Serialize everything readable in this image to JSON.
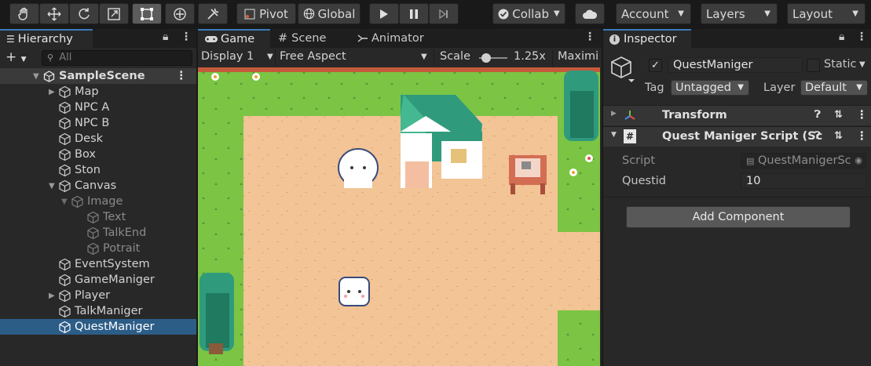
{
  "toolbar": {
    "pivot_label": "Pivot",
    "global_label": "Global",
    "collab_label": "Collab",
    "account_label": "Account",
    "layers_label": "Layers",
    "layout_label": "Layout"
  },
  "hierarchy": {
    "tab_label": "Hierarchy",
    "add_label": "+",
    "search_placeholder": "All",
    "scene_name": "SampleScene",
    "items": [
      {
        "label": "Map"
      },
      {
        "label": "NPC A"
      },
      {
        "label": "NPC B"
      },
      {
        "label": "Desk"
      },
      {
        "label": "Box"
      },
      {
        "label": "Ston"
      },
      {
        "label": "Canvas"
      },
      {
        "label": "Image"
      },
      {
        "label": "Text"
      },
      {
        "label": "TalkEnd"
      },
      {
        "label": "Potrait"
      },
      {
        "label": "EventSystem"
      },
      {
        "label": "GameManiger"
      },
      {
        "label": "Player"
      },
      {
        "label": "TalkManiger"
      },
      {
        "label": "QuestManiger"
      }
    ]
  },
  "game_view": {
    "tabs": [
      {
        "label": "Game"
      },
      {
        "label": "Scene"
      },
      {
        "label": "Animator"
      }
    ],
    "display": "Display 1",
    "aspect": "Free Aspect",
    "scale_label": "Scale",
    "scale_value": "1.25x",
    "maximize_label": "Maximi"
  },
  "inspector": {
    "tab_label": "Inspector",
    "object_name": "QuestManiger",
    "static_label": "Static",
    "tag_label": "Tag",
    "tag_value": "Untagged",
    "layer_label": "Layer",
    "layer_value": "Default",
    "components": [
      {
        "name": "Transform"
      },
      {
        "name": "Quest Maniger Script (Sc"
      }
    ],
    "script_label": "Script",
    "script_value": "QuestManigerSc",
    "questid_label": "Questid",
    "questid_value": "10",
    "add_component_label": "Add Component"
  },
  "colors": {
    "selection": "#2c5d87",
    "accent_tab": "#3a79bb",
    "grass": "#7cc444",
    "dirt": "#f2c496"
  }
}
